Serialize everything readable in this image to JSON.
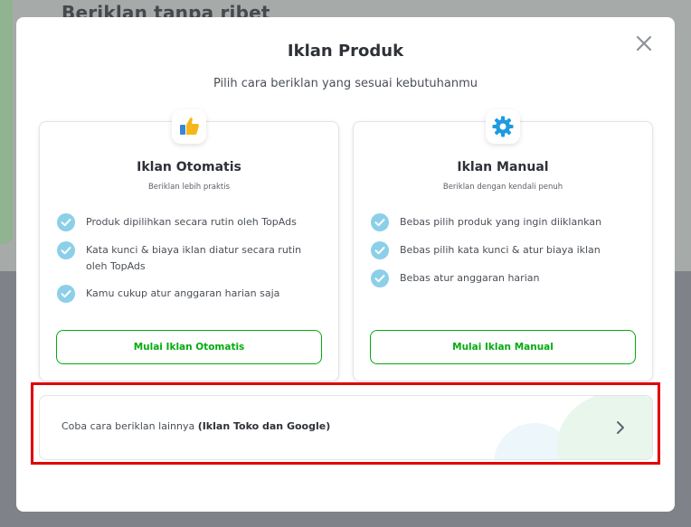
{
  "background": {
    "heading": "Beriklan tanpa ribet"
  },
  "modal": {
    "title": "Iklan Produk",
    "subtitle": "Pilih cara beriklan yang sesuai kebutuhanmu",
    "close_icon": "close-icon"
  },
  "cards": [
    {
      "icon": "thumbs-up-icon",
      "title": "Iklan Otomatis",
      "subtitle": "Beriklan lebih praktis",
      "features": [
        "Produk dipilihkan secara rutin oleh TopAds",
        "Kata kunci & biaya iklan diatur secara rutin oleh TopAds",
        "Kamu cukup atur anggaran harian saja"
      ],
      "button": "Mulai Iklan Otomatis"
    },
    {
      "icon": "gear-icon",
      "title": "Iklan Manual",
      "subtitle": "Beriklan dengan kendali penuh",
      "features": [
        "Bebas pilih produk yang ingin diiklankan",
        "Bebas pilih kata kunci & atur biaya iklan",
        "Bebas atur anggaran harian"
      ],
      "button": "Mulai Iklan Manual"
    }
  ],
  "other_option": {
    "prefix": "Coba cara beriklan lainnya ",
    "emphasis": "(Iklan Toko dan Google)",
    "icon": "chevron-right-icon"
  },
  "colors": {
    "accent_green": "#03ac0e",
    "check_blue": "#8ccfe9",
    "highlight_red": "#e00000"
  }
}
